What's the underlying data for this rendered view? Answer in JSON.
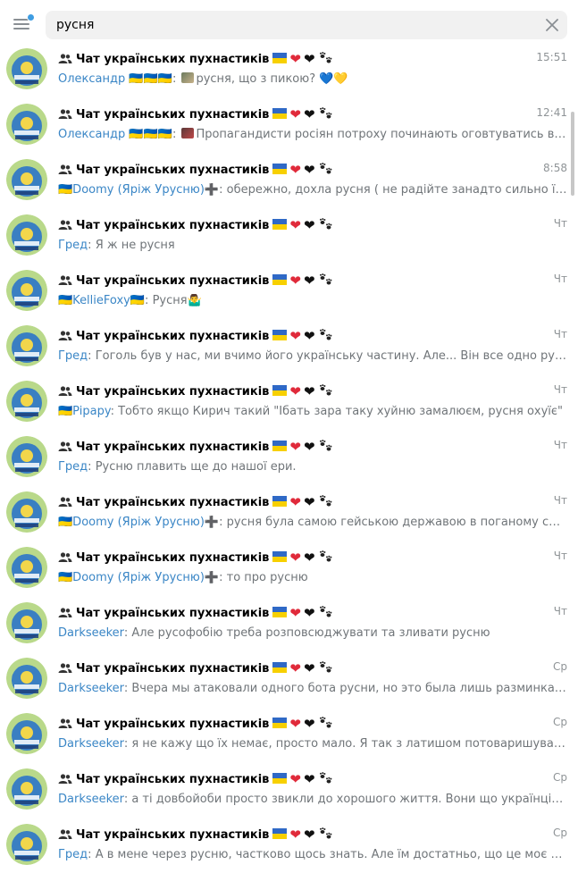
{
  "search": {
    "value": "русня"
  },
  "menu": {
    "has_unread_dot": true
  },
  "colors": {
    "accent": "#3a86c6",
    "ua_blue": "#2f69c6",
    "ua_yellow": "#f7d000"
  },
  "icons": {
    "menu": "hamburger-menu-icon",
    "clear": "close-icon",
    "group": "group-people-icon",
    "avatar": "furry-paw-logo-avatar",
    "paw": "paw-prints-emoji",
    "hearts": [
      "red-heart-emoji",
      "black-heart-emoji"
    ]
  },
  "results": [
    {
      "chat_title": "Чат українських пухнастиків",
      "time": "15:51",
      "sender": "Олександр 🇺🇦🇺🇦🇺🇦",
      "text": "русня, що з пикою? 💙💛",
      "has_thumb": true
    },
    {
      "chat_title": "Чат українських пухнастиків",
      "time": "12:41",
      "sender": "Олександр 🇺🇦🇺🇦🇺🇦",
      "text": "Пропагандисти росіян потроху починають оговтуватись від пер...",
      "has_thumb": true
    },
    {
      "chat_title": "Чат українських пухнастиків",
      "time": "8:58",
      "sender": "🇺🇦Doomy (Яріж Урусню)➕",
      "text": "обережно, дохла русня ( не радійте занадто сильно її там мало)",
      "has_thumb": false
    },
    {
      "chat_title": "Чат українських пухнастиків",
      "time": "Чт",
      "sender": "Гред",
      "text": "Я ж не русня",
      "has_thumb": false
    },
    {
      "chat_title": "Чат українських пухнастиків",
      "time": "Чт",
      "sender": "🇺🇦KellieFoxy🇺🇦",
      "text": "Русня🤷‍♂️",
      "has_thumb": false
    },
    {
      "chat_title": "Чат українських пухнастиків",
      "time": "Чт",
      "sender": "Гред",
      "text": "Гоголь був у нас, ми вчимо його українську частину. Але... Він все одно русня...",
      "has_thumb": false
    },
    {
      "chat_title": "Чат українських пухнастиків",
      "time": "Чт",
      "sender": "🇺🇦Pipapy",
      "text": "Тобто якщо Кирич такий \"Їбать зара таку хуйню замалюєм, русня охуїє\"",
      "has_thumb": false
    },
    {
      "chat_title": "Чат українських пухнастиків",
      "time": "Чт",
      "sender": "Гред",
      "text": "Русню плавить ще до нашої ери.",
      "has_thumb": false
    },
    {
      "chat_title": "Чат українських пухнастиків",
      "time": "Чт",
      "sender": "🇺🇦Doomy (Яріж Урусню)➕",
      "text": "русня була самою гейською державою в поганому сенсі цьог...",
      "has_thumb": false
    },
    {
      "chat_title": "Чат українських пухнастиків",
      "time": "Чт",
      "sender": "🇺🇦Doomy (Яріж Урусню)➕",
      "text": "то про русню",
      "has_thumb": false
    },
    {
      "chat_title": "Чат українських пухнастиків",
      "time": "Чт",
      "sender": "Darkseeker",
      "text": "Але русофобію треба розповсюджувати та зливати русню",
      "has_thumb": false
    },
    {
      "chat_title": "Чат українських пухнастиків",
      "time": "Ср",
      "sender": "Darkseeker",
      "text": "Вчера мы атаковали одного бота русни, но это была лишь разминка. Сегодня...",
      "has_thumb": false
    },
    {
      "chat_title": "Чат українських пухнастиків",
      "time": "Ср",
      "sender": "Darkseeker",
      "text": "я не кажу що їх немає, просто мало. Я так з латишом потоваришував коли ми ...",
      "has_thumb": false
    },
    {
      "chat_title": "Чат українських пухнастиків",
      "time": "Ср",
      "sender": "Darkseeker",
      "text": "а ті довбойоби просто звикли до хорошого життя. Вони що українців жаліють...",
      "has_thumb": false
    },
    {
      "chat_title": "Чат українських пухнастиків",
      "time": "Ср",
      "sender": "Гред",
      "text": "А в мене через русню, частково щось знать. Але їм достатньо, що це моє оточення.",
      "has_thumb": false
    }
  ]
}
